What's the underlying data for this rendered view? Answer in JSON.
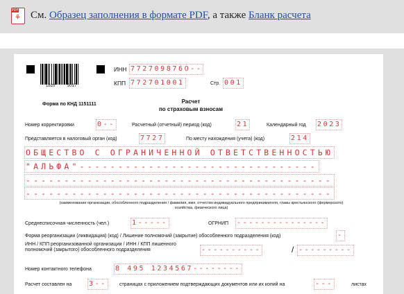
{
  "header": {
    "icon": "pdf-file-icon",
    "prefix": "См.",
    "link_sample": "Образец заполнения в формате PDF",
    "middle": ", а также",
    "link_blank": "Бланк расчета"
  },
  "form": {
    "barcode_left": "1820",
    "barcode_right": "5017",
    "inn_label": "ИНН",
    "inn_value": "772709876О--",
    "kpp_label": "КПП",
    "kpp_value": "772701001",
    "page_label": "Стр.",
    "page_value": "001",
    "knd_label": "Форма по КНД 1151111",
    "title_line1": "Расчет",
    "title_line2": "по страховым взносам",
    "corr_label": "Номер корректировки",
    "corr_value": "0--",
    "period_label": "Расчетный (отчетный) период (код)",
    "period_value": "21",
    "year_label": "Календарный год",
    "year_value": "2023",
    "tax_organ_label": "Представляется в налоговый орган (код)",
    "tax_organ_value": "7727",
    "location_label": "По месту нахождения (учета) (код)",
    "location_value": "214",
    "org_line1": "ОБЩЕСТВО С ОГРАНИЧЕННОЙ ОТВЕТСТВЕННОСТЬЮ",
    "org_line2": "\"АЛЬФА\"-------------------------------",
    "org_line3": "----------------------------------------",
    "org_line4": "----------------------------------------",
    "org_note": "(наименование организации, обособленного подразделения / фамилия, имя, отчество индивидуального предпринимателя, главы крестьянского (фермерского) хозяйства, физического лица)",
    "headcount_label": "Среднесписочная численность (чел.)",
    "headcount_value": "1-----",
    "ogrnip_label": "ОГРНИП",
    "ogrnip_value": "---------------",
    "reorg_label": "Форма реорганизации (ликвидация) (код) / Лишение полномочий (закрытие) обособленного подразделения (код)",
    "reorg_value": "-",
    "reorg_inn_label": "ИНН / КПП реорганизованной организации / ИНН / КПП лишенного полномочий (закрытого) обособленного подразделения",
    "reorg_inn_value": "----------",
    "reorg_kpp_value": "---------",
    "phone_label": "Номер контактного телефона",
    "phone_value": "8 495 1234567--------",
    "pages_label": "Расчет составлен на",
    "pages_value": "3--",
    "pages_middle": "страницах с приложением подтверждающих документов или их копий на",
    "attach_value": "---",
    "sheets_label": "листах"
  }
}
